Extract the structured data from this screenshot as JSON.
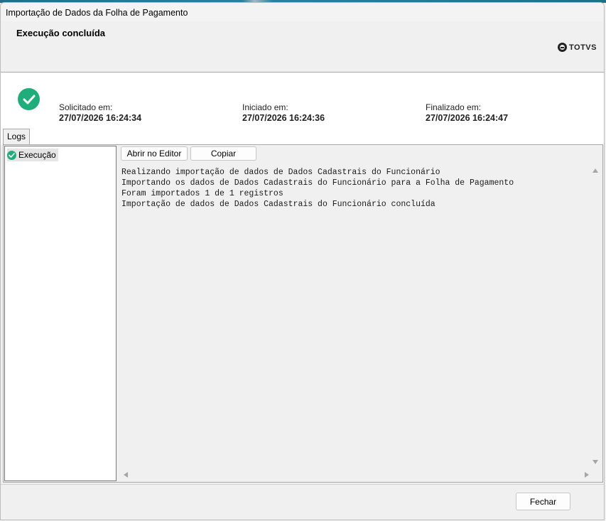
{
  "window": {
    "title": "Importação de Dados da Folha de Pagamento"
  },
  "header": {
    "status_title": "Execução concluída",
    "logo_text": "TOTVS"
  },
  "info": {
    "requested_label": "Solicitado em:",
    "requested_value": "27/07/2026 16:24:34",
    "started_label": "Iniciado em:",
    "started_value": "27/07/2026 16:24:36",
    "finished_label": "Finalizado em:",
    "finished_value": "27/07/2026 16:24:47"
  },
  "tabs": {
    "logs": "Logs"
  },
  "tree": {
    "items": [
      {
        "label": "Execução"
      }
    ]
  },
  "toolbar": {
    "open_editor_label": "Abrir no Editor",
    "copy_label": "Copiar"
  },
  "log": {
    "lines": [
      "Realizando importação de dados de Dados Cadastrais do Funcionário",
      "Importando os dados de Dados Cadastrais do Funcionário para a Folha de Pagamento",
      "Foram importados 1 de 1 registros",
      "Importação de dados de Dados Cadastrais do Funcionário concluída"
    ]
  },
  "footer": {
    "close_label": "Fechar"
  },
  "colors": {
    "success": "#1fae7b",
    "panel_bg": "#f0f0f0",
    "border": "#a8a8a8"
  }
}
